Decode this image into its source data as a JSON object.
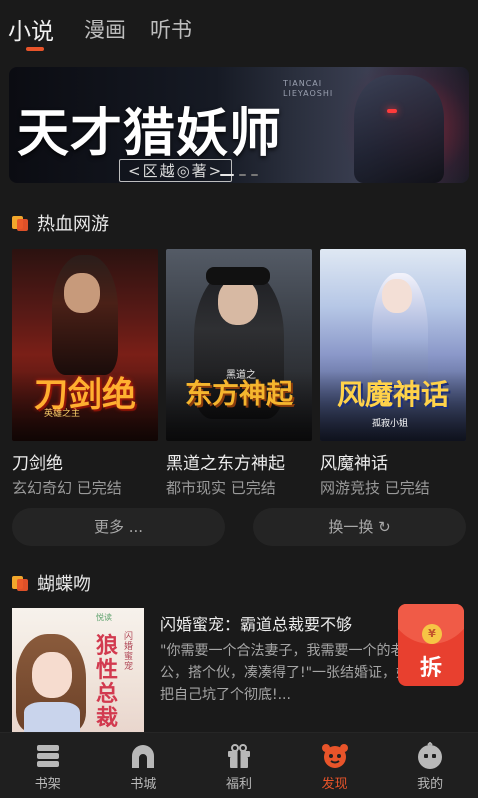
{
  "top_tabs": [
    {
      "label": "小说",
      "active": true
    },
    {
      "label": "漫画",
      "active": false
    },
    {
      "label": "听书",
      "active": false
    }
  ],
  "banner": {
    "title": "天才猎妖师",
    "author_line": "<区越◎著>",
    "latin_line1": "TIANCAI",
    "latin_line2": "LIEYAOSHI",
    "dot_count": 3,
    "active_dot": 0
  },
  "section_hot": {
    "title": "热血网游",
    "books": [
      {
        "cover_title": "刀剑绝",
        "cover_small": "英雄之主",
        "name": "刀剑绝",
        "meta": "玄幻奇幻 已完结"
      },
      {
        "cover_title": "东方神起",
        "cover_small": "黑道之",
        "name": "黑道之东方神起",
        "meta": "都市现实 已完结"
      },
      {
        "cover_title": "风魔神话",
        "cover_small": "孤寂小姐",
        "name": "风魔神话",
        "meta": "网游竞技 已完结"
      }
    ],
    "more_label": "更多 ...",
    "refresh_label": "换一换 ↻"
  },
  "section_butterfly": {
    "title": "蝴蝶吻",
    "featured": {
      "title": "闪婚蜜宠：霸道总裁要不够",
      "description": "\"你需要一个合法妻子，我需要一个的老公，搭个伙，凑凑得了!\"一张结婚证，她把自己坑了个彻底!...",
      "cover_title": "狼性总裁",
      "cover_vertical": "闪婚蜜宠",
      "cover_logo": "悦读"
    }
  },
  "red_packet": {
    "coin": "¥",
    "label": "拆"
  },
  "bottom_nav": [
    {
      "label": "书架",
      "icon": "bookshelf-icon",
      "active": false
    },
    {
      "label": "书城",
      "icon": "bookstore-icon",
      "active": false
    },
    {
      "label": "福利",
      "icon": "gift-icon",
      "active": false
    },
    {
      "label": "发现",
      "icon": "discover-icon",
      "active": true
    },
    {
      "label": "我的",
      "icon": "profile-icon",
      "active": false
    }
  ],
  "colors": {
    "accent": "#e8542a",
    "background": "#1a1a1a",
    "nav_inactive": "#b8b8b8"
  }
}
